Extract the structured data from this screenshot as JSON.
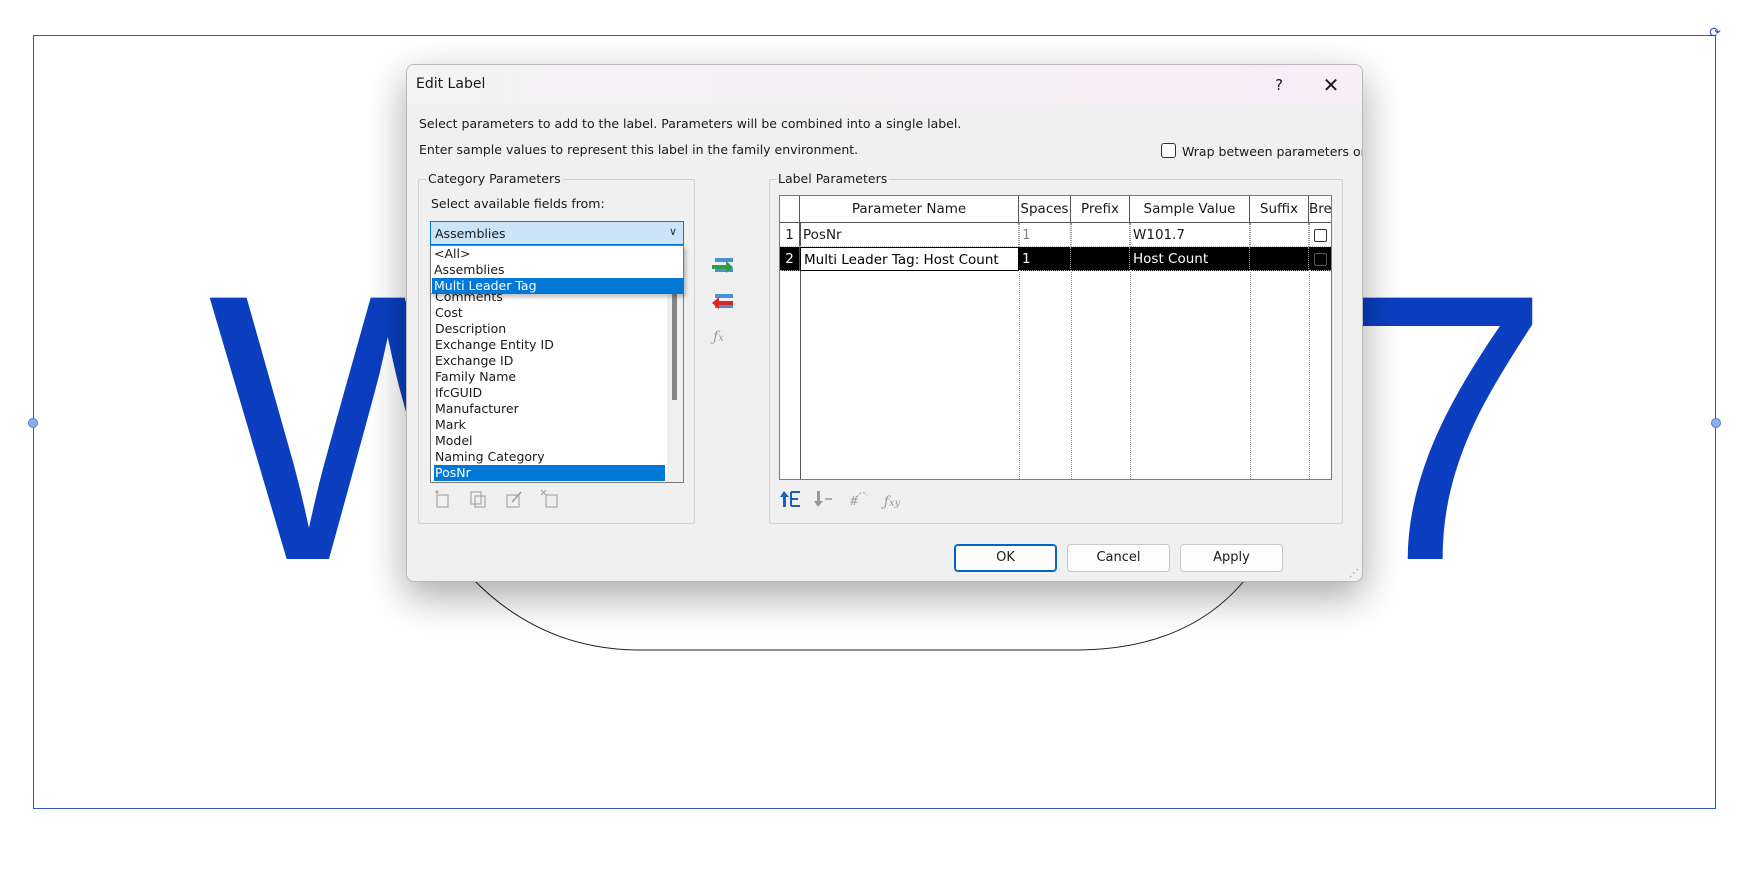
{
  "canvas": {
    "big_text_left": "W",
    "big_text_right": "7",
    "accent_color": "#0b3fc0",
    "frame_color": "#2f55c8"
  },
  "dialog": {
    "title": "Edit Label",
    "help_label": "?",
    "close_label": "✕",
    "instruction_1": "Select parameters to add to the label.  Parameters will be combined into a single label.",
    "instruction_2": "Enter sample values to represent this label in the family environment.",
    "wrap_checkbox_label": "Wrap between parameters only",
    "wrap_checked": false
  },
  "category_parameters": {
    "group_title": "Category Parameters",
    "select_label": "Select available fields from:",
    "combo_value": "Assemblies",
    "dropdown_options": [
      "<All>",
      "Assemblies",
      "Multi Leader Tag"
    ],
    "dropdown_selected": "Multi Leader Tag",
    "list_items": [
      "Comments",
      "Cost",
      "Description",
      "Exchange Entity ID",
      "Exchange ID",
      "Family Name",
      "IfcGUID",
      "Manufacturer",
      "Mark",
      "Model",
      "Naming Category",
      "PosNr"
    ],
    "list_selected": "PosNr",
    "tool_icons": [
      "new-parameter-icon",
      "edit-parameter-icon",
      "rename-parameter-icon",
      "delete-parameter-icon"
    ]
  },
  "transfer_icons": [
    "add-parameter-arrow-icon",
    "remove-parameter-arrow-icon",
    "function-icon"
  ],
  "label_parameters": {
    "group_title": "Label Parameters",
    "columns": [
      "Parameter Name",
      "Spaces",
      "Prefix",
      "Sample Value",
      "Suffix",
      "Break"
    ],
    "rows": [
      {
        "num": "1",
        "name": "PosNr",
        "spaces": "1",
        "prefix": "",
        "sample": "W101.7",
        "suffix": "",
        "break": false
      },
      {
        "num": "2",
        "name": "Multi Leader Tag: Host Count",
        "spaces": "1",
        "prefix": "",
        "sample": "Host Count",
        "suffix": "",
        "break": false
      }
    ],
    "selected_row": 2,
    "tool_icons": [
      "move-up-icon",
      "move-down-icon",
      "number-format-icon",
      "formula-icon"
    ]
  },
  "buttons": {
    "ok": "OK",
    "cancel": "Cancel",
    "apply": "Apply"
  }
}
